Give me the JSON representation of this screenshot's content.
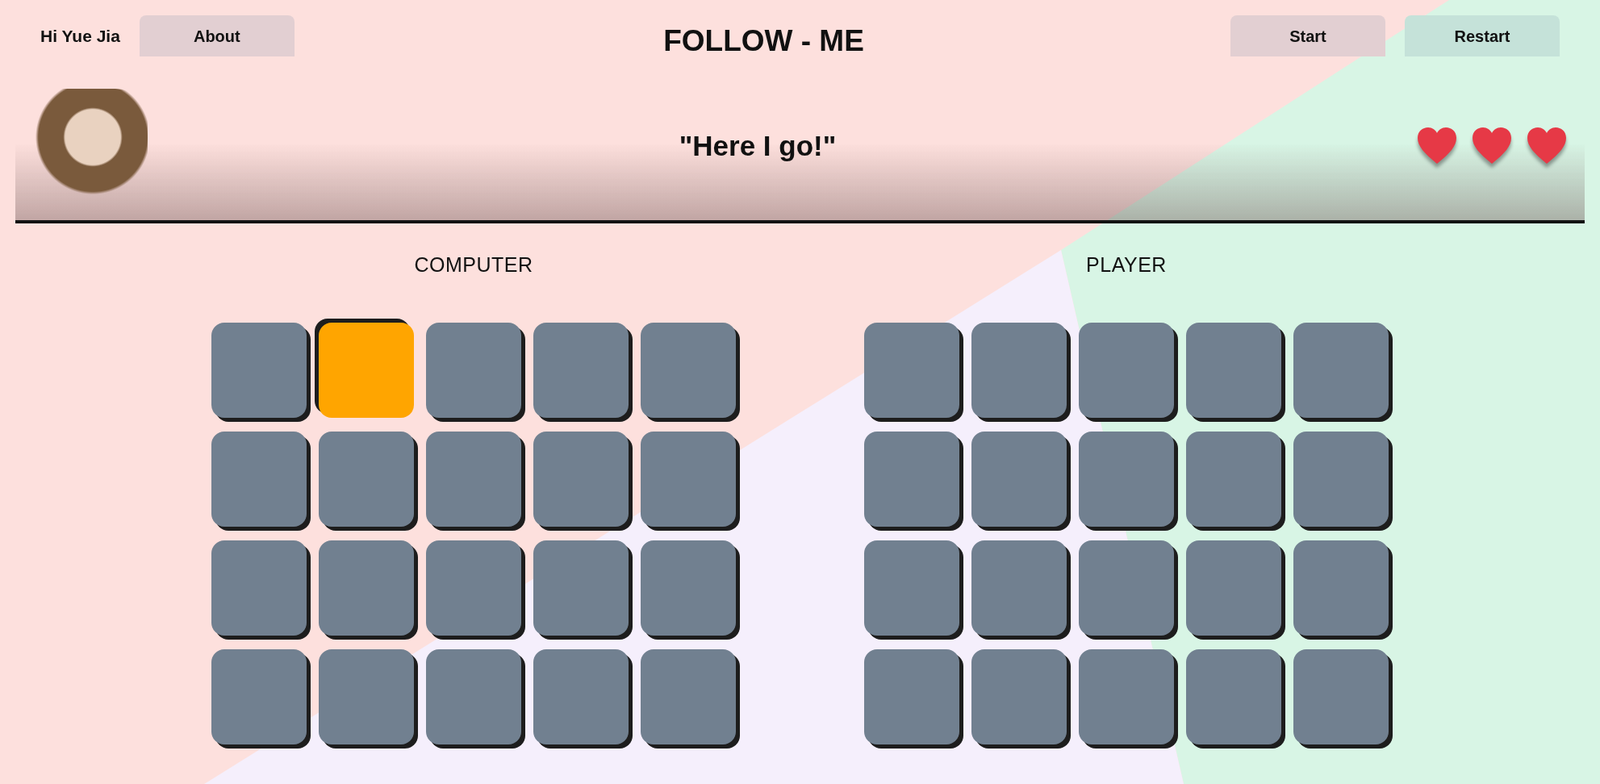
{
  "header": {
    "greeting": "Hi Yue Jia",
    "title": "FOLLOW - ME"
  },
  "buttons": {
    "about": "About",
    "start": "Start",
    "restart": "Restart"
  },
  "speech": "\"Here I go!\"",
  "lives": [
    {
      "filled": true
    },
    {
      "filled": true
    },
    {
      "filled": true
    }
  ],
  "boards": [
    {
      "label": "COMPUTER",
      "tiles": [
        {
          "lit": false
        },
        {
          "lit": true
        },
        {
          "lit": false
        },
        {
          "lit": false
        },
        {
          "lit": false
        },
        {
          "lit": false
        },
        {
          "lit": false
        },
        {
          "lit": false
        },
        {
          "lit": false
        },
        {
          "lit": false
        },
        {
          "lit": false
        },
        {
          "lit": false
        },
        {
          "lit": false
        },
        {
          "lit": false
        },
        {
          "lit": false
        },
        {
          "lit": false
        },
        {
          "lit": false
        },
        {
          "lit": false
        },
        {
          "lit": false
        },
        {
          "lit": false
        }
      ]
    },
    {
      "label": "PLAYER",
      "tiles": [
        {
          "lit": false
        },
        {
          "lit": false
        },
        {
          "lit": false
        },
        {
          "lit": false
        },
        {
          "lit": false
        },
        {
          "lit": false
        },
        {
          "lit": false
        },
        {
          "lit": false
        },
        {
          "lit": false
        },
        {
          "lit": false
        },
        {
          "lit": false
        },
        {
          "lit": false
        },
        {
          "lit": false
        },
        {
          "lit": false
        },
        {
          "lit": false
        },
        {
          "lit": false
        },
        {
          "lit": false
        },
        {
          "lit": false
        },
        {
          "lit": false
        },
        {
          "lit": false
        }
      ]
    }
  ]
}
